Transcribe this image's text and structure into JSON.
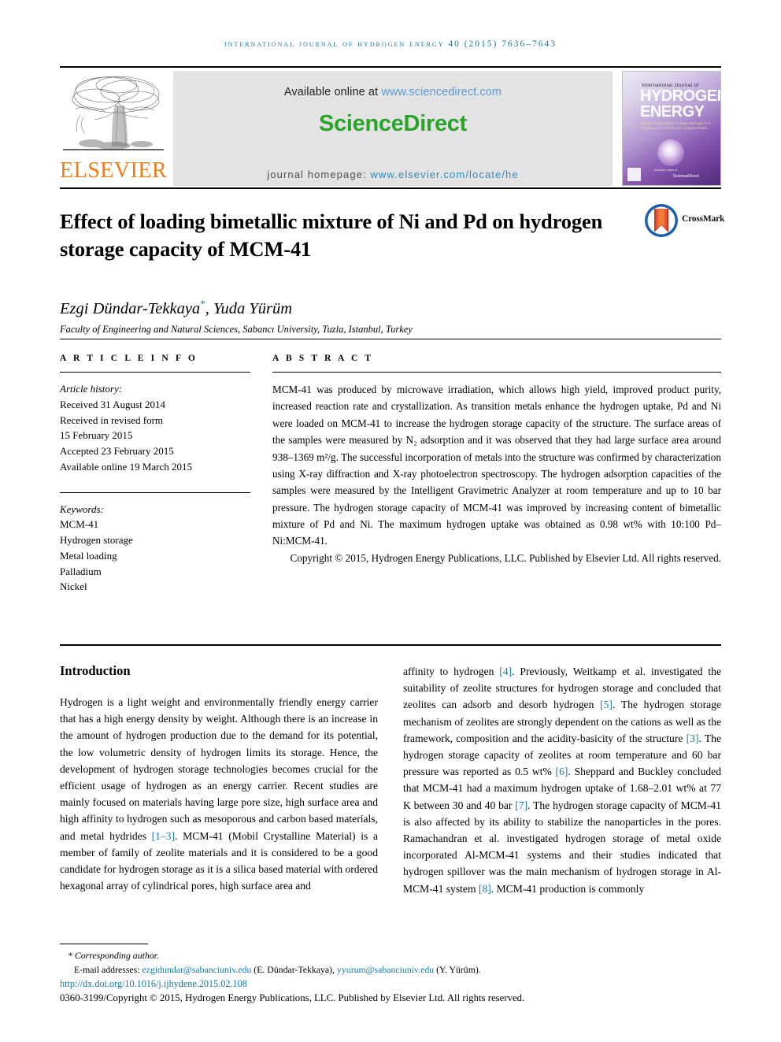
{
  "running_head": "International Journal of Hydrogen Energy 40 (2015) 7636–7643",
  "masthead": {
    "elsevier_wordmark": "ELSEVIER",
    "available_online_prefix": "Available online at ",
    "available_online_link": "www.sciencedirect.com",
    "sciencedirect_logo": "ScienceDirect",
    "homepage_prefix": "journal homepage: ",
    "homepage_link": "www.elsevier.com/locate/he",
    "cover": {
      "line_top": "International Journal of",
      "word1": "HYDROGEN",
      "word2": "ENERGY",
      "editors": "Editors: Craig Perkins, T. Nejat Veziroglu, D.Y. Goswami, S.A. Sherif, C.E. Grégoire Padró",
      "sciencedirect_mark": "ScienceDirect",
      "sciencedirect_sub": "Available online at"
    }
  },
  "title_block": {
    "title": "Effect of loading bimetallic mixture of Ni and Pd on hydrogen storage capacity of MCM-41",
    "crossmark_label": "CrossMark",
    "authors": "Ezgi Dündar-Tekkaya",
    "authors_star": "*",
    "authors_rest": ", Yuda Yürüm",
    "affiliation": "Faculty of Engineering and Natural Sciences, Sabancı University, Tuzla, Istanbul, Turkey"
  },
  "article_info": {
    "heading": "A R T I C L E   I N F O",
    "history_label": "Article history:",
    "history_lines": [
      "Received 31 August 2014",
      "Received in revised form",
      "15 February 2015",
      "Accepted 23 February 2015",
      "Available online 19 March 2015"
    ],
    "keywords_label": "Keywords:",
    "keywords": [
      "MCM-41",
      "Hydrogen storage",
      "Metal loading",
      "Palladium",
      "Nickel"
    ]
  },
  "abstract": {
    "heading": "A B S T R A C T",
    "text": "MCM-41 was produced by microwave irradiation, which allows high yield, improved product purity, increased reaction rate and crystallization. As transition metals enhance the hydrogen uptake, Pd and Ni were loaded on MCM-41 to increase the hydrogen storage capacity of the structure. The surface areas of the samples were measured by N₂ adsorption and it was observed that they had large surface area around 938–1369 m²/g. The successful incorporation of metals into the structure was confirmed by characterization using X-ray diffraction and X-ray photoelectron spectroscopy. The hydrogen adsorption capacities of the samples were measured by the Intelligent Gravimetric Analyzer at room temperature and up to 10 bar pressure. The hydrogen storage capacity of MCM-41 was improved by increasing content of bimetallic mixture of Pd and Ni. The maximum hydrogen uptake was obtained as 0.98 wt% with 10:100 Pd–Ni:MCM-41.",
    "copyright": "Copyright © 2015, Hydrogen Energy Publications, LLC. Published by Elsevier Ltd. All rights reserved."
  },
  "introduction": {
    "heading": "Introduction",
    "left_column": "Hydrogen is a light weight and environmentally friendly energy carrier that has a high energy density by weight. Although there is an increase in the amount of hydrogen production due to the demand for its potential, the low volumetric density of hydrogen limits its storage. Hence, the development of hydrogen storage technologies becomes crucial for the efficient usage of hydrogen as an energy carrier. Recent studies are mainly focused on materials having large pore size, high surface area and high affinity to hydrogen such as mesoporous and carbon based materials, and metal hydrides [1–3]. MCM-41 (Mobil Crystalline Material) is a member of family of zeolite materials and it is considered to be a good candidate for hydrogen storage as it is a silica based material with ordered hexagonal array of cylindrical pores, high surface area and",
    "right_column": "affinity to hydrogen [4]. Previously, Weitkamp et al. investigated the suitability of zeolite structures for hydrogen storage and concluded that zeolites can adsorb and desorb hydrogen [5]. The hydrogen storage mechanism of zeolites are strongly dependent on the cations as well as the framework, composition and the acidity-basicity of the structure [3]. The hydrogen storage capacity of zeolites at room temperature and 60 bar pressure was reported as 0.5 wt% [6]. Sheppard and Buckley concluded that MCM-41 had a maximum hydrogen uptake of 1.68–2.01 wt% at 77 K between 30 and 40 bar [7]. The hydrogen storage capacity of MCM-41 is also affected by its ability to stabilize the nanoparticles in the pores. Ramachandran et al. investigated hydrogen storage of metal oxide incorporated Al-MCM-41 systems and their studies indicated that hydrogen spillover was the main mechanism of hydrogen storage in Al-MCM-41 system [8]. MCM-41 production is commonly"
  },
  "footnote": {
    "corresponding": "* Corresponding author.",
    "email_label": "E-mail addresses: ",
    "email1": "ezgidundar@sabanciuniv.edu",
    "email1_owner": " (E. Dündar-Tekkaya), ",
    "email2": "yyurum@sabanciuniv.edu",
    "email2_owner": " (Y. Yürüm).",
    "doi": "http://dx.doi.org/10.1016/j.ijhydene.2015.02.108",
    "issn": "0360-3199/Copyright © 2015, Hydrogen Energy Publications, LLC. Published by Elsevier Ltd. All rights reserved."
  },
  "colors": {
    "link_blue": "#1379a7",
    "sciencedirect_green": "#29a329",
    "elsevier_orange": "#ef7d1a",
    "banner_grey": "#e3e3e3"
  }
}
